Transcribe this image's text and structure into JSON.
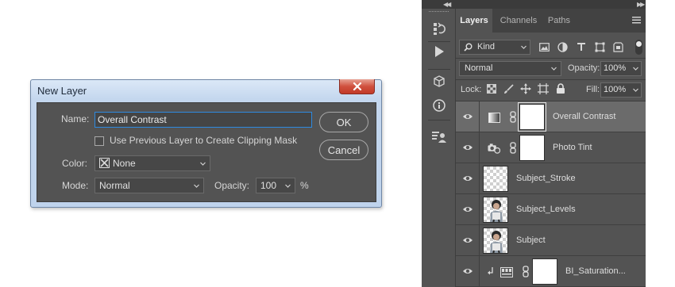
{
  "dialog": {
    "title": "New Layer",
    "close_icon": "close-icon",
    "name_label": "Name:",
    "name_value": "Overall Contrast",
    "clipping_checkbox_label": "Use Previous Layer to Create Clipping Mask",
    "clipping_checked": false,
    "color_label": "Color:",
    "color_value": "None",
    "mode_label": "Mode:",
    "mode_value": "Normal",
    "opacity_label": "Opacity:",
    "opacity_value": "100",
    "opacity_unit": "%",
    "ok_label": "OK",
    "cancel_label": "Cancel"
  },
  "panel": {
    "tabs": [
      {
        "label": "Layers",
        "active": true
      },
      {
        "label": "Channels",
        "active": false
      },
      {
        "label": "Paths",
        "active": false
      }
    ],
    "filter_kind": "Kind",
    "blend_mode": "Normal",
    "opacity_label": "Opacity:",
    "opacity_value": "100%",
    "lock_label": "Lock:",
    "fill_label": "Fill:",
    "fill_value": "100%",
    "layers": [
      {
        "name": "Overall Contrast",
        "selected": true,
        "type": "gradient-fill-adjustment"
      },
      {
        "name": "Photo Tint",
        "selected": false,
        "type": "photo-filter-adjustment"
      },
      {
        "name": "Subject_Stroke",
        "selected": false,
        "type": "pixel-transparent"
      },
      {
        "name": "Subject_Levels",
        "selected": false,
        "type": "pixel-subject"
      },
      {
        "name": "Subject",
        "selected": false,
        "type": "pixel-subject"
      },
      {
        "name": "BI_Saturation...",
        "selected": false,
        "type": "hue-saturation-adjustment",
        "clipped": true
      }
    ]
  },
  "colors": {
    "dialog_bg": "#535353",
    "panel_bg": "#535353",
    "selected_layer": "#6b6b6b",
    "focus_blue": "#2e8ae0",
    "close_red": "#c23a27"
  }
}
